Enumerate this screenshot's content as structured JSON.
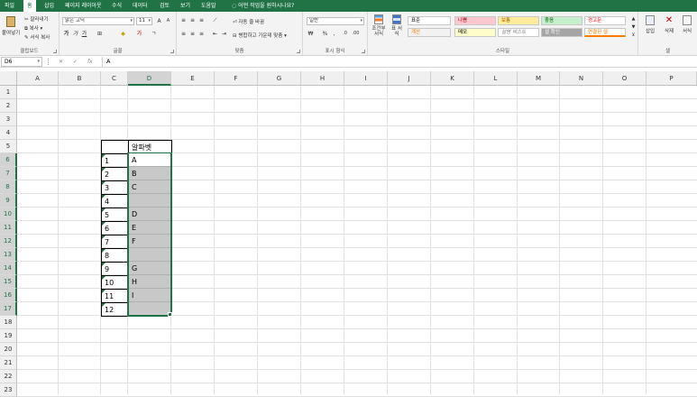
{
  "ribbon_tabs": [
    "파일",
    "홈",
    "삽입",
    "페이지 레이아웃",
    "수식",
    "데이터",
    "검토",
    "보기",
    "도움말"
  ],
  "active_tab": "홈",
  "tell_me": "어떤 작업을 원하시나요?",
  "clipboard": {
    "paste": "붙여넣기",
    "cut": "잘라내기",
    "copy": "복사",
    "format_painter": "서식 복사",
    "label": "클립보드"
  },
  "font": {
    "name": "맑은 고딕",
    "size": "11",
    "label": "글꼴"
  },
  "alignment": {
    "wrap": "자동 줄 바꿈",
    "merge": "병합하고 가운데 맞춤",
    "label": "맞춤"
  },
  "number": {
    "format": "일반",
    "label": "표시 형식"
  },
  "styles": {
    "conditional": "조건부 서식",
    "table": "표 서식",
    "cells": [
      {
        "label": "표준",
        "bg": "#ffffff",
        "fg": "#000000"
      },
      {
        "label": "나쁨",
        "bg": "#ffc7ce",
        "fg": "#9c0006"
      },
      {
        "label": "보통",
        "bg": "#ffeb9c",
        "fg": "#9c5700"
      },
      {
        "label": "좋음",
        "bg": "#c6efce",
        "fg": "#006100"
      },
      {
        "label": "경고문",
        "bg": "#ffffff",
        "fg": "#ff0000"
      },
      {
        "label": "계산",
        "bg": "#f2f2f2",
        "fg": "#fa7d00"
      },
      {
        "label": "메모",
        "bg": "#ffffcc",
        "fg": "#000000"
      },
      {
        "label": "설명 텍스트",
        "bg": "#ffffff",
        "fg": "#7f7f7f"
      },
      {
        "label": "셀 확인",
        "bg": "#a5a5a5",
        "fg": "#ffffff"
      },
      {
        "label": "연결된 셀",
        "bg": "#ffffff",
        "fg": "#fa7d00"
      }
    ],
    "label": "스타일"
  },
  "cells_group": {
    "insert": "삽입",
    "delete": "삭제",
    "format": "서식",
    "label": "셀"
  },
  "formula_bar": {
    "name_box": "D6",
    "value": "A"
  },
  "columns": [
    "A",
    "B",
    "C",
    "D",
    "E",
    "F",
    "G",
    "H",
    "I",
    "J",
    "K",
    "L",
    "M",
    "N",
    "O",
    "P"
  ],
  "rows": [
    "1",
    "2",
    "3",
    "4",
    "5",
    "6",
    "7",
    "8",
    "9",
    "10",
    "11",
    "12",
    "13",
    "14",
    "15",
    "16",
    "17",
    "18",
    "19",
    "20",
    "21",
    "22",
    "23"
  ],
  "table": {
    "header": "알파벳",
    "numbers": [
      "1",
      "2",
      "3",
      "4",
      "5",
      "6",
      "7",
      "8",
      "9",
      "10",
      "11",
      "12"
    ],
    "letters": [
      "A",
      "B",
      "C",
      "",
      "D",
      "E",
      "F",
      "",
      "G",
      "H",
      "I",
      ""
    ]
  },
  "colors": {
    "accent": "#217346"
  }
}
